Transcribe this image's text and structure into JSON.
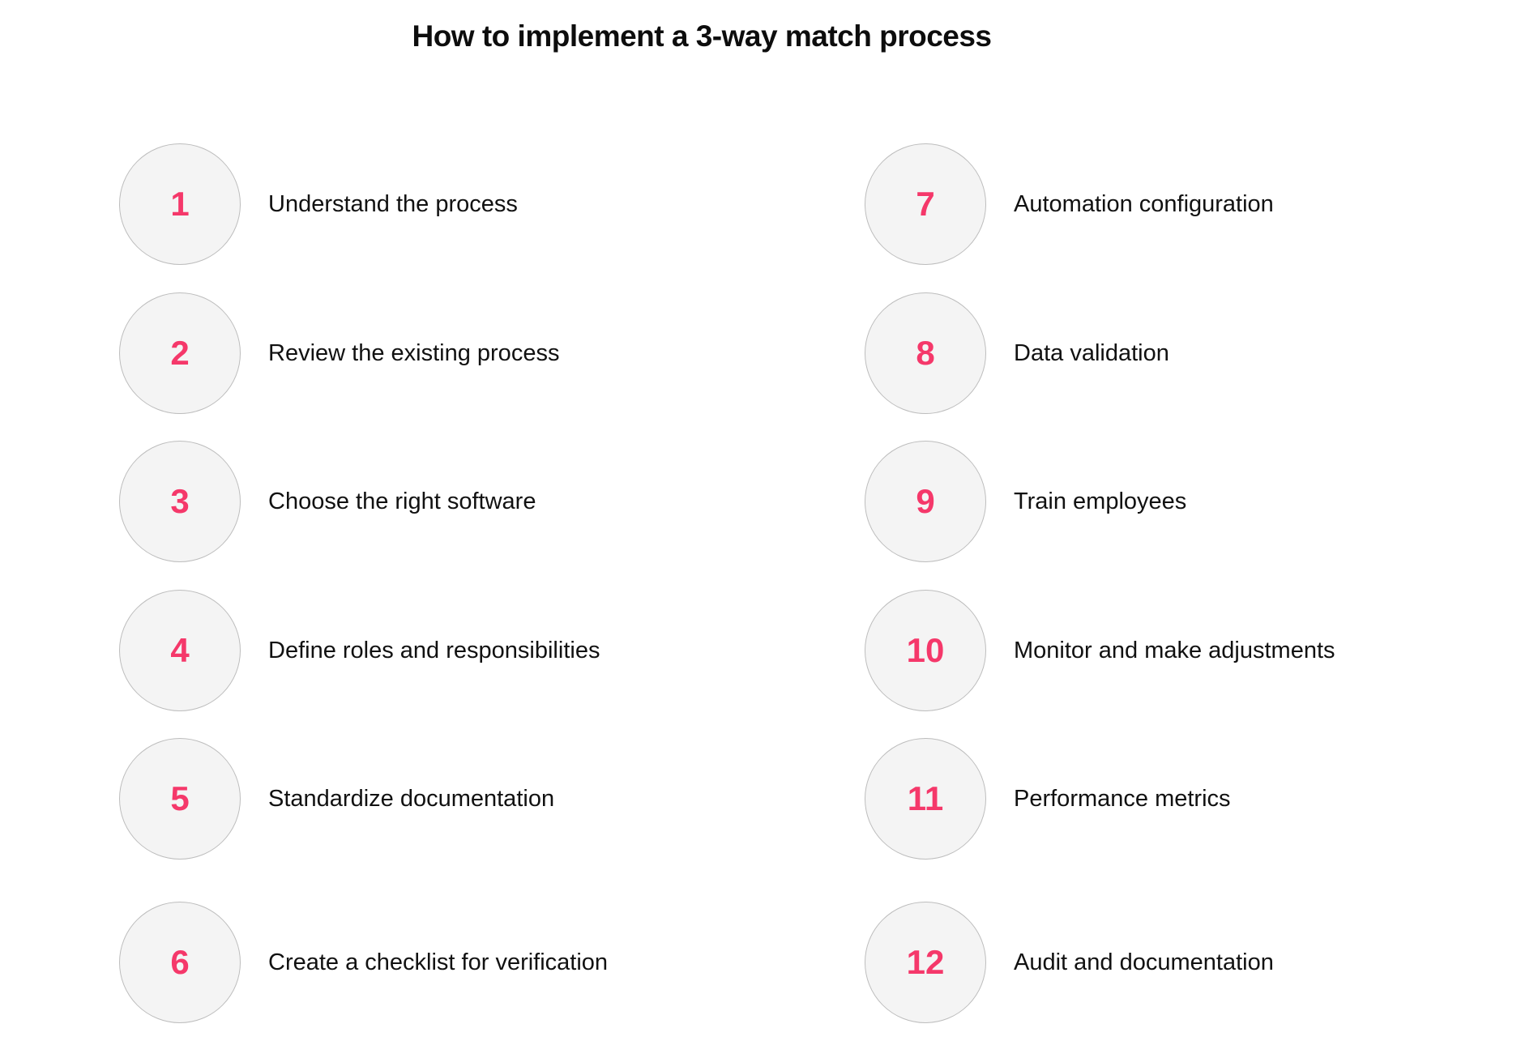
{
  "title": "How to implement a 3-way match process",
  "colors": {
    "accent": "#f5386a",
    "circle_fill": "#f4f4f4",
    "circle_border": "#bdbdbd",
    "text": "#111111"
  },
  "steps": [
    {
      "number": "1",
      "label": "Understand the process"
    },
    {
      "number": "2",
      "label": "Review the existing process"
    },
    {
      "number": "3",
      "label": "Choose the right software"
    },
    {
      "number": "4",
      "label": "Define roles and responsibilities"
    },
    {
      "number": "5",
      "label": "Standardize documentation"
    },
    {
      "number": "6",
      "label": "Create a checklist for verification"
    },
    {
      "number": "7",
      "label": "Automation configuration"
    },
    {
      "number": "8",
      "label": "Data validation"
    },
    {
      "number": "9",
      "label": "Train employees"
    },
    {
      "number": "10",
      "label": "Monitor and make adjustments"
    },
    {
      "number": "11",
      "label": "Performance metrics"
    },
    {
      "number": "12",
      "label": "Audit and documentation"
    }
  ]
}
